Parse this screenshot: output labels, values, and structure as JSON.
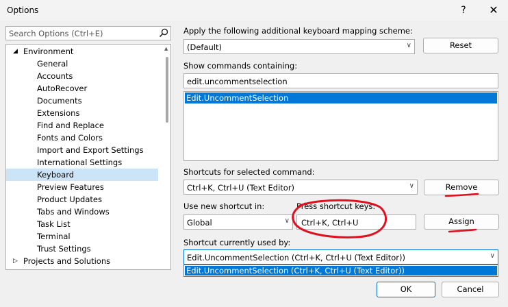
{
  "window": {
    "title": "Options",
    "help_label": "?",
    "close_label": "✕"
  },
  "search": {
    "placeholder": "Search Options (Ctrl+E)"
  },
  "tree": {
    "items": [
      {
        "label": "Environment",
        "level": 0,
        "expanded": true
      },
      {
        "label": "General",
        "level": 1
      },
      {
        "label": "Accounts",
        "level": 1
      },
      {
        "label": "AutoRecover",
        "level": 1
      },
      {
        "label": "Documents",
        "level": 1
      },
      {
        "label": "Extensions",
        "level": 1
      },
      {
        "label": "Find and Replace",
        "level": 1
      },
      {
        "label": "Fonts and Colors",
        "level": 1
      },
      {
        "label": "Import and Export Settings",
        "level": 1
      },
      {
        "label": "International Settings",
        "level": 1
      },
      {
        "label": "Keyboard",
        "level": 1,
        "selected": true
      },
      {
        "label": "Preview Features",
        "level": 1
      },
      {
        "label": "Product Updates",
        "level": 1
      },
      {
        "label": "Tabs and Windows",
        "level": 1
      },
      {
        "label": "Task List",
        "level": 1
      },
      {
        "label": "Terminal",
        "level": 1
      },
      {
        "label": "Trust Settings",
        "level": 1
      },
      {
        "label": "Projects and Solutions",
        "level": 0,
        "expanded": false
      }
    ]
  },
  "keyboard": {
    "mapping_label": "Apply the following additional keyboard mapping scheme:",
    "mapping_value": "(Default)",
    "reset_label": "Reset",
    "show_commands_label": "Show commands containing:",
    "command_filter": "edit.uncommentselection",
    "commands": [
      "Edit.UncommentSelection"
    ],
    "shortcuts_label": "Shortcuts for selected command:",
    "shortcut_value": "Ctrl+K, Ctrl+U (Text Editor)",
    "remove_label": "Remove",
    "use_shortcut_in_label": "Use new shortcut in:",
    "use_shortcut_in_value": "Global",
    "press_keys_label": "Press shortcut keys:",
    "press_keys_value": "Ctrl+K, Ctrl+U",
    "assign_label": "Assign",
    "currently_used_label": "Shortcut currently used by:",
    "currently_used_value": "Edit.UncommentSelection (Ctrl+K, Ctrl+U (Text Editor))",
    "currently_used_options": [
      "Edit.UncommentSelection (Ctrl+K, Ctrl+U (Text Editor))"
    ]
  },
  "footer": {
    "ok_label": "OK",
    "cancel_label": "Cancel"
  },
  "colors": {
    "selection_blue": "#0078d7",
    "tree_selection": "#cce4f7",
    "annotation_red": "#e0101e"
  }
}
